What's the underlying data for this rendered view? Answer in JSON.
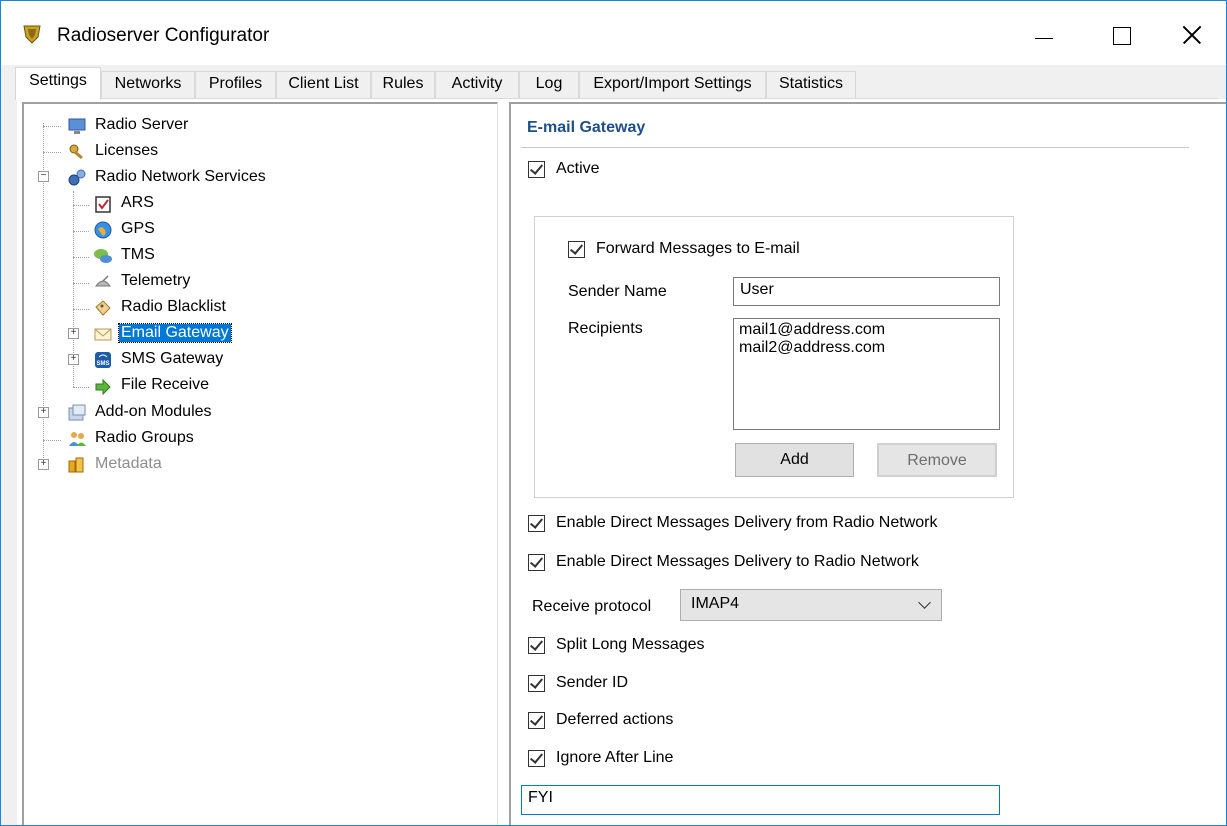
{
  "window": {
    "title": "Radioserver Configurator"
  },
  "tabs": [
    {
      "label": "Settings",
      "active": true
    },
    {
      "label": "Networks"
    },
    {
      "label": "Profiles"
    },
    {
      "label": "Client List"
    },
    {
      "label": "Rules"
    },
    {
      "label": "Activity"
    },
    {
      "label": "Log"
    },
    {
      "label": "Export/Import Settings"
    },
    {
      "label": "Statistics"
    }
  ],
  "tree": {
    "items": [
      {
        "label": "Radio Server",
        "icon": "monitor-icon"
      },
      {
        "label": "Licenses",
        "icon": "key-icon"
      },
      {
        "label": "Radio Network Services",
        "icon": "gears-icon"
      },
      {
        "label": "ARS",
        "icon": "clipboard-check-icon"
      },
      {
        "label": "GPS",
        "icon": "globe-icon"
      },
      {
        "label": "TMS",
        "icon": "chat-icon"
      },
      {
        "label": "Telemetry",
        "icon": "satellite-icon"
      },
      {
        "label": "Radio Blacklist",
        "icon": "tag-icon"
      },
      {
        "label": "Email Gateway",
        "icon": "envelope-icon",
        "selected": true
      },
      {
        "label": "SMS Gateway",
        "icon": "sms-icon"
      },
      {
        "label": "File Receive",
        "icon": "arrow-icon"
      },
      {
        "label": "Add-on Modules",
        "icon": "modules-icon"
      },
      {
        "label": "Radio Groups",
        "icon": "users-icon"
      },
      {
        "label": "Metadata",
        "icon": "database-icon",
        "disabled": true
      }
    ]
  },
  "email_gateway": {
    "title": "E-mail Gateway",
    "active_label": "Active",
    "forward_label": "Forward Messages to E-mail",
    "sender_name_label": "Sender Name",
    "sender_name_value": "User",
    "recipients_label": "Recipients",
    "recipients": [
      "mail1@address.com",
      "mail2@address.com"
    ],
    "add_label": "Add",
    "remove_label": "Remove",
    "direct_from_label": "Enable Direct Messages Delivery from Radio Network",
    "direct_to_label": "Enable Direct Messages Delivery to Radio Network",
    "receive_protocol_label": "Receive protocol",
    "receive_protocol_value": "IMAP4",
    "split_label": "Split Long Messages",
    "sender_id_label": "Sender ID",
    "deferred_label": "Deferred actions",
    "ignore_after_label": "Ignore After Line",
    "ignore_after_value": "FYI"
  },
  "colors": {
    "accent": "#0078d7",
    "section_title": "#1f4e8c"
  }
}
